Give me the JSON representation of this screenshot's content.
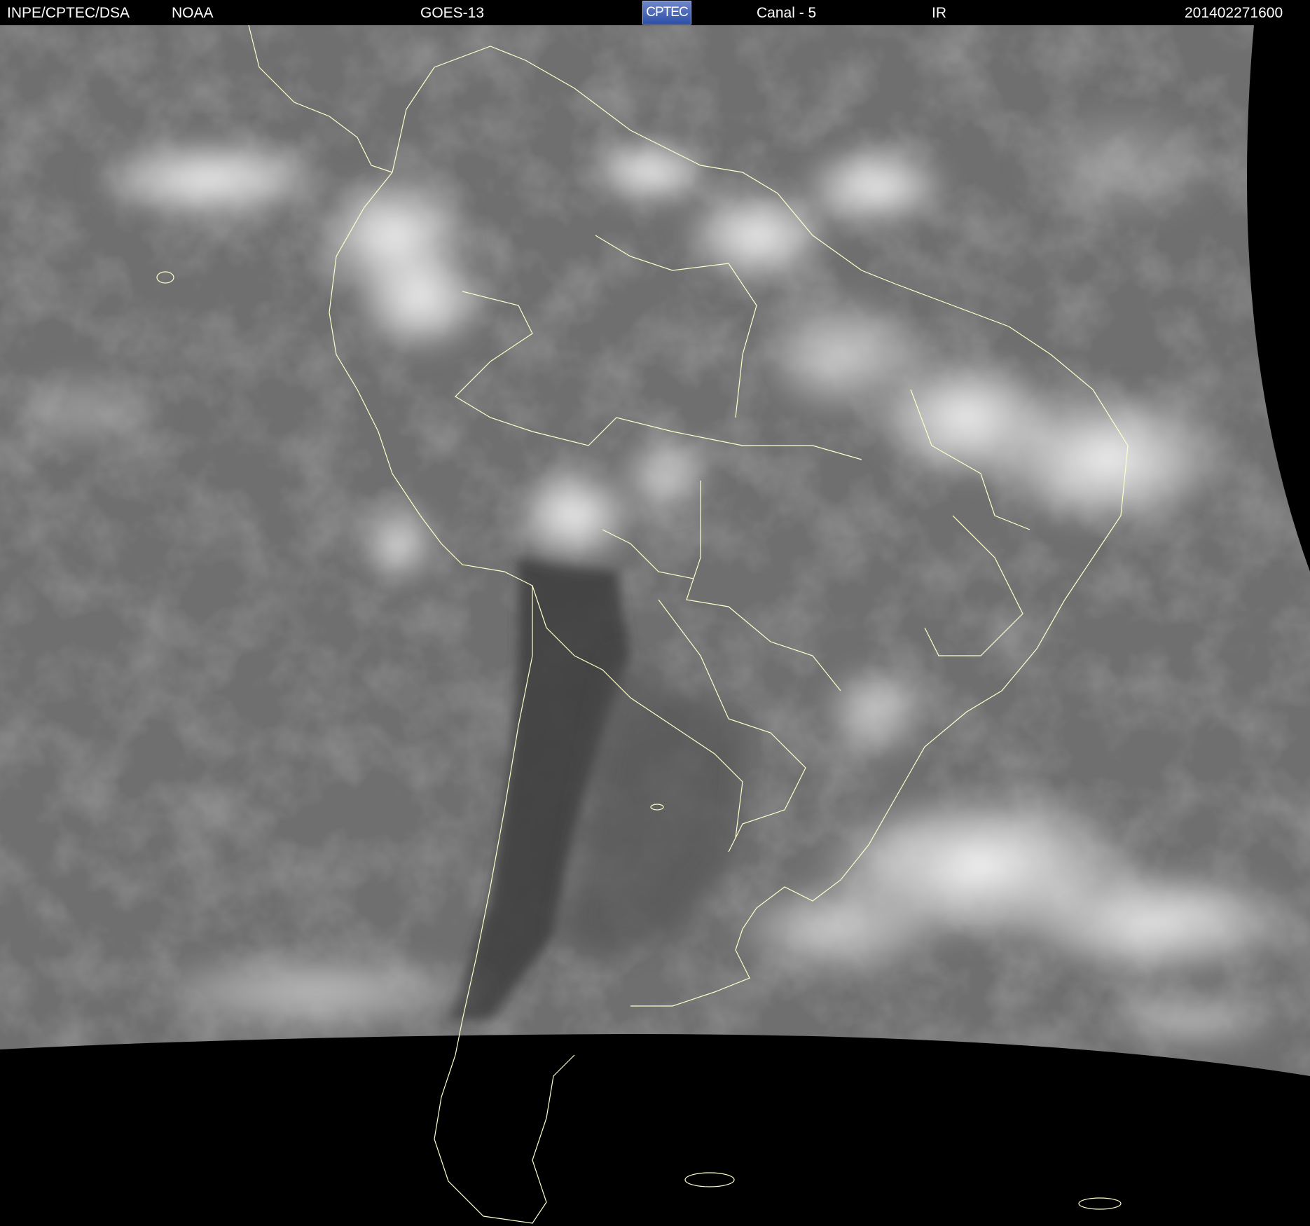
{
  "header": {
    "institution": "INPE/CPTEC/DSA",
    "agency": "NOAA",
    "satellite": "GOES-13",
    "logo_text": "CPTEC",
    "channel": "Canal - 5",
    "band": "IR",
    "timestamp": "201402271600"
  },
  "colors": {
    "background": "#000000",
    "coastline": "#ffffcc",
    "cloud": "#ffffff",
    "land_dark": "#3a3a3a"
  }
}
